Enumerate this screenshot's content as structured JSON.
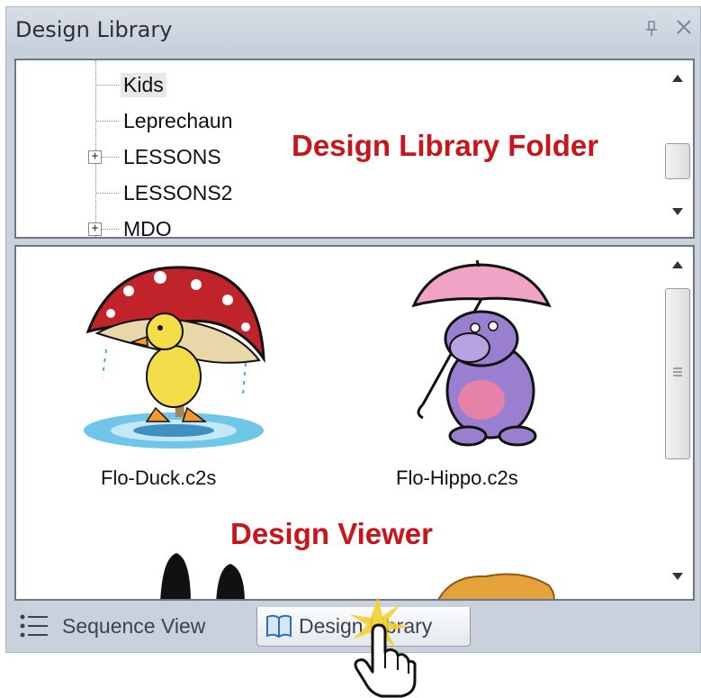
{
  "panel": {
    "title": "Design Library",
    "pin_icon": "pin-icon",
    "close_icon": "close-icon",
    "pin_glyph": "⎅",
    "close_glyph": "✕"
  },
  "tree": {
    "items": [
      {
        "label": "Kids",
        "selected": true,
        "expandable": false
      },
      {
        "label": "Leprechaun",
        "selected": false,
        "expandable": false
      },
      {
        "label": "LESSONS",
        "selected": false,
        "expandable": true
      },
      {
        "label": "LESSONS2",
        "selected": false,
        "expandable": false
      },
      {
        "label": "MDO",
        "selected": false,
        "expandable": true
      }
    ],
    "annotation": "Design Library Folder"
  },
  "viewer": {
    "thumbnails": [
      {
        "file": "Flo-Duck.c2s"
      },
      {
        "file": "Flo-Hippo.c2s"
      }
    ],
    "annotation": "Design Viewer"
  },
  "tabs": [
    {
      "label": "Sequence View",
      "icon": "list-icon",
      "active": false
    },
    {
      "label": "Design Library",
      "icon": "book-icon",
      "active": true
    }
  ],
  "colors": {
    "annotation": "#c8151b",
    "panel_bg": "#c9d1dc",
    "border": "#6e7784"
  }
}
